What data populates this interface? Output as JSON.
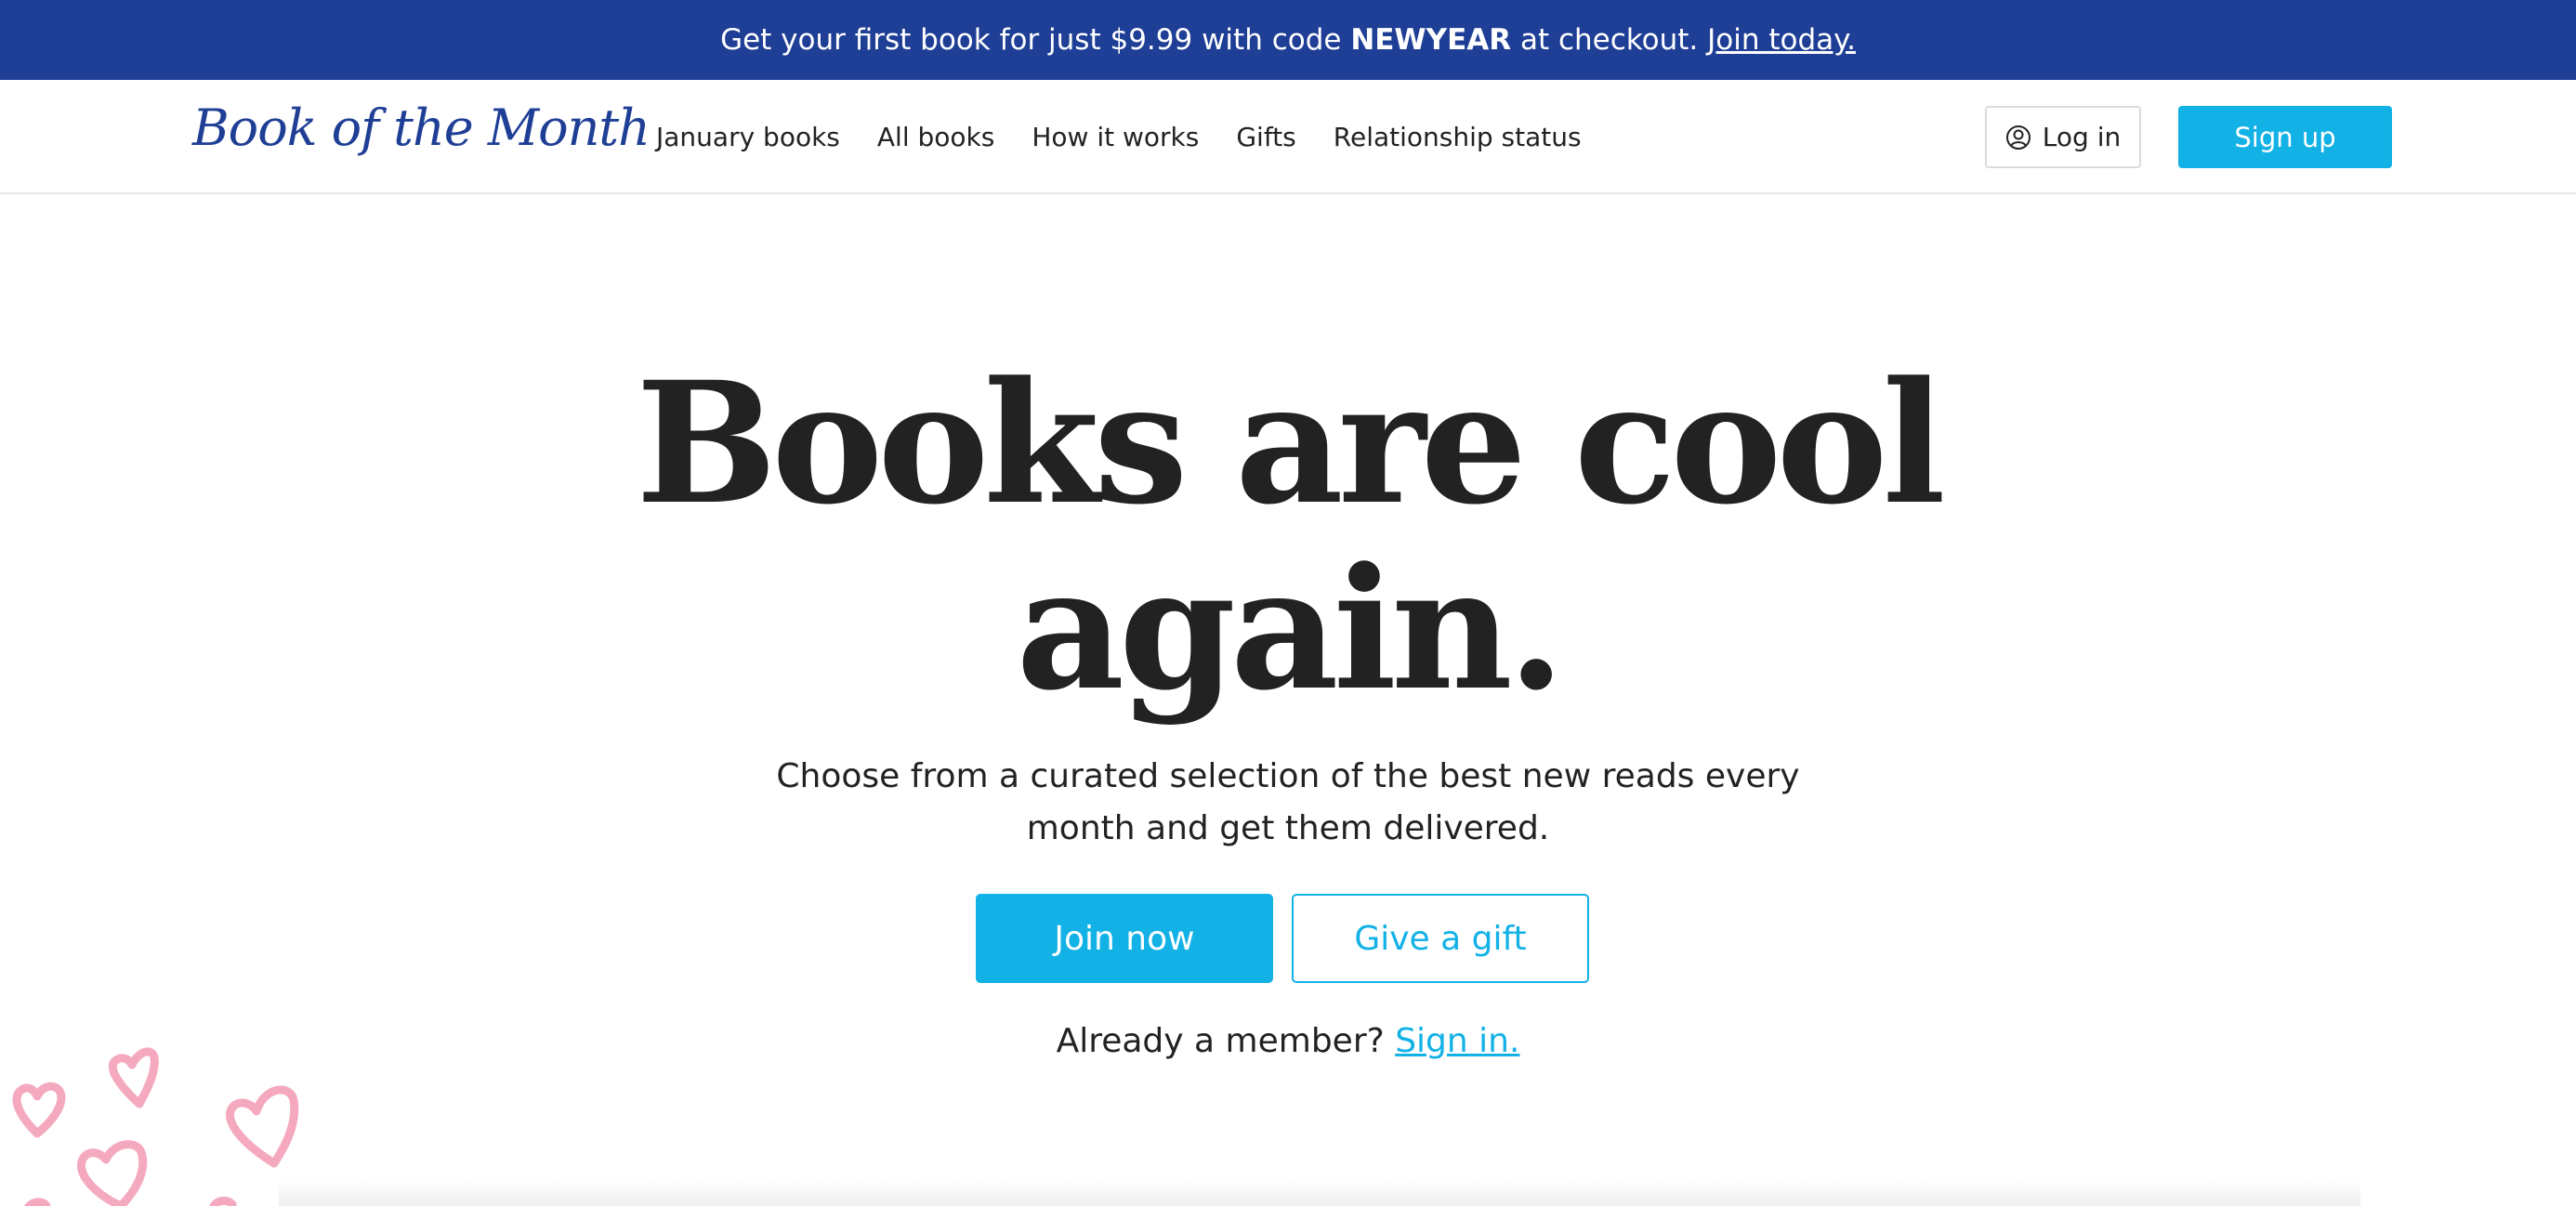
{
  "promo": {
    "text_before": "Get your first book for just $9.99 with code ",
    "code": "NEWYEAR",
    "text_after": " at checkout. ",
    "link": "Join today.",
    "bg_color": "#1f3f96"
  },
  "header": {
    "logo": "Book of the Month",
    "nav": [
      "January books",
      "All books",
      "How it works",
      "Gifts",
      "Relationship status"
    ],
    "login_label": "Log in",
    "login_icon": "user-circle-icon",
    "signup_label": "Sign up",
    "accent_color": "#12b1e6"
  },
  "hero": {
    "title_line1": "Books are cool",
    "title_line2": "again.",
    "subtitle_line1": "Choose from a curated selection of the best new reads every",
    "subtitle_line2": "month and get them delivered.",
    "join_label": "Join now",
    "gift_label": "Give a gift",
    "member_prompt": "Already a member?",
    "signin_label": "Sign in."
  },
  "decor": {
    "hearts_icon": "heart-icon",
    "hearts_color": "#f4a9bf"
  }
}
